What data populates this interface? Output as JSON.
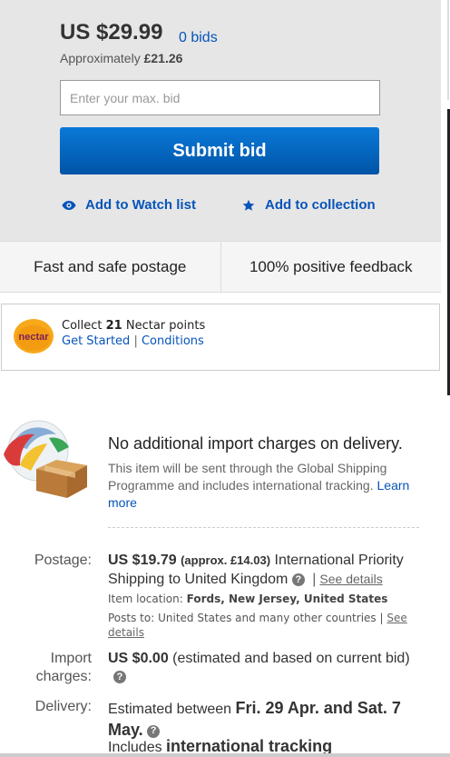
{
  "bid": {
    "price": "US $29.99",
    "bids": "0 bids",
    "approx_prefix": "Approximately",
    "approx_value": "£21.26",
    "input_placeholder": "Enter your max. bid",
    "submit_label": "Submit bid",
    "watch_label": "Add to Watch list",
    "collection_label": "Add to collection"
  },
  "features": [
    "Fast and safe postage",
    "100% positive feedback"
  ],
  "nectar": {
    "logo_text": "nectar",
    "collect_prefix": "Collect",
    "points": "21",
    "collect_suffix": "Nectar points",
    "get_started": "Get Started",
    "separator": "|",
    "conditions": "Conditions"
  },
  "gsp": {
    "title": "No additional import charges on delivery.",
    "description": "This item will be sent through the Global Shipping Programme and includes international tracking.",
    "learn_more": "Learn more"
  },
  "postage": {
    "label": "Postage:",
    "price": "US $19.79",
    "approx": "(approx. £14.03)",
    "service": "International Priority Shipping to United Kingdom",
    "help": "?",
    "separator": "|",
    "see_details": "See details",
    "item_location_label": "Item location:",
    "item_location": "Fords, New Jersey, United States",
    "posts_to_label": "Posts to:",
    "posts_to": "United States and many other countries",
    "posts_separator": "|",
    "posts_see_details": "See details"
  },
  "import": {
    "label": "Import charges:",
    "price": "US $0.00",
    "note": "(estimated and based on current bid)",
    "help": "?"
  },
  "delivery": {
    "label": "Delivery:",
    "prefix": "Estimated between",
    "range": "Fri. 29 Apr. and Sat. 7 May.",
    "help": "?",
    "includes": "Includes",
    "tracking": "international tracking"
  },
  "colors": {
    "link": "#0654ba",
    "button_top": "#0a79d8",
    "button_bottom": "#0054a6",
    "panel_bg": "#e6e6e6",
    "nectar_orange": "#f39c12"
  },
  "icons": {
    "watch": "eye-icon",
    "collection": "star-icon",
    "help": "question-circle-icon",
    "gsp": "globe-parcel-icon",
    "nectar": "nectar-logo"
  }
}
